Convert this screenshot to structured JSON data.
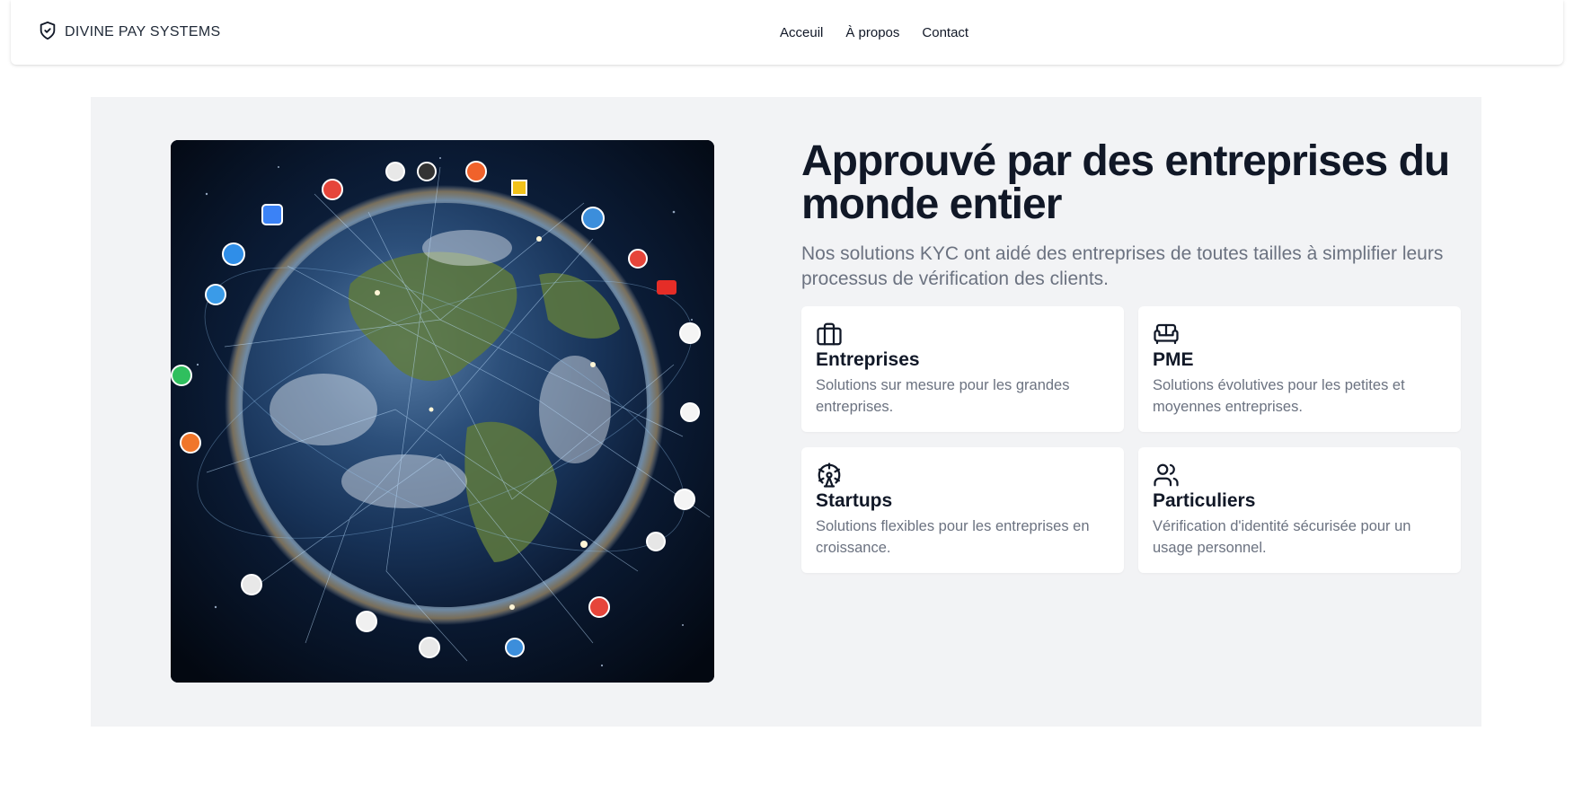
{
  "brand": {
    "name": "DIVINE PAY SYSTEMS",
    "icon": "shield-check-icon"
  },
  "nav": {
    "links": [
      "Acceuil",
      "À propos",
      "Contact"
    ]
  },
  "hero": {
    "image_alt": "globe-network-image",
    "title": "Approuvé par des entreprises du monde entier",
    "subtitle": "Nos solutions KYC ont aidé des entreprises de toutes tailles à simplifier leurs processus de vérification des clients."
  },
  "cards": [
    {
      "icon": "briefcase-icon",
      "title": "Entreprises",
      "description": "Solutions sur mesure pour les grandes entreprises."
    },
    {
      "icon": "sofa-icon",
      "title": "PME",
      "description": "Solutions évolutives pour les petites et moyennes entreprises."
    },
    {
      "icon": "ferris-wheel-icon",
      "title": "Startups",
      "description": "Solutions flexibles pour les entreprises en croissance."
    },
    {
      "icon": "users-icon",
      "title": "Particuliers",
      "description": "Vérification d'identité sécurisée pour un usage personnel."
    }
  ],
  "colors": {
    "section_bg": "#f2f3f5",
    "heading": "#111827",
    "muted": "#6b7280",
    "card_bg": "#ffffff"
  }
}
